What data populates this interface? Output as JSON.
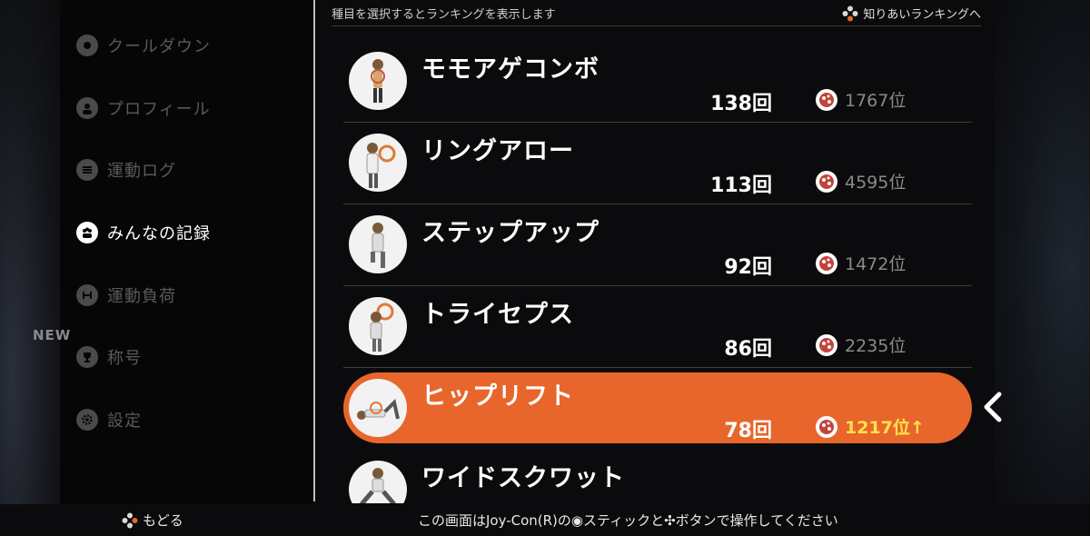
{
  "sidebar": {
    "items": [
      {
        "label": "クールダウン",
        "icon": "cooldown-icon"
      },
      {
        "label": "プロフィール",
        "icon": "profile-icon"
      },
      {
        "label": "運動ログ",
        "icon": "list-icon"
      },
      {
        "label": "みんなの記録",
        "icon": "people-icon"
      },
      {
        "label": "運動負荷",
        "icon": "dumbbell-icon"
      },
      {
        "label": "称号",
        "icon": "trophy-icon"
      },
      {
        "label": "設定",
        "icon": "gear-icon"
      }
    ],
    "active_index": 3,
    "new_badge": "NEW"
  },
  "header": {
    "hint": "種目を選択するとランキングを表示します",
    "friends_link": "知りあいランキングへ"
  },
  "exercises": [
    {
      "name": "モモアゲコンボ",
      "count": "138回",
      "rank": "1767位"
    },
    {
      "name": "リングアロー",
      "count": "113回",
      "rank": "4595位"
    },
    {
      "name": "ステップアップ",
      "count": "92回",
      "rank": "1472位"
    },
    {
      "name": "トライセプス",
      "count": "86回",
      "rank": "2235位"
    },
    {
      "name": "ヒップリフト",
      "count": "78回",
      "rank": "1217位↑"
    },
    {
      "name": "ワイドスクワット",
      "count": "",
      "rank": ""
    }
  ],
  "selected_index": 4,
  "footer": {
    "back_label": "もどる",
    "hint": "この画面はJoy-Con(R)の◉スティックと✣ボタンで操作してください"
  },
  "colors": {
    "selected_row": "#e8662c",
    "rank_highlight": "#ffe14a",
    "background": "#0b0b0d"
  }
}
